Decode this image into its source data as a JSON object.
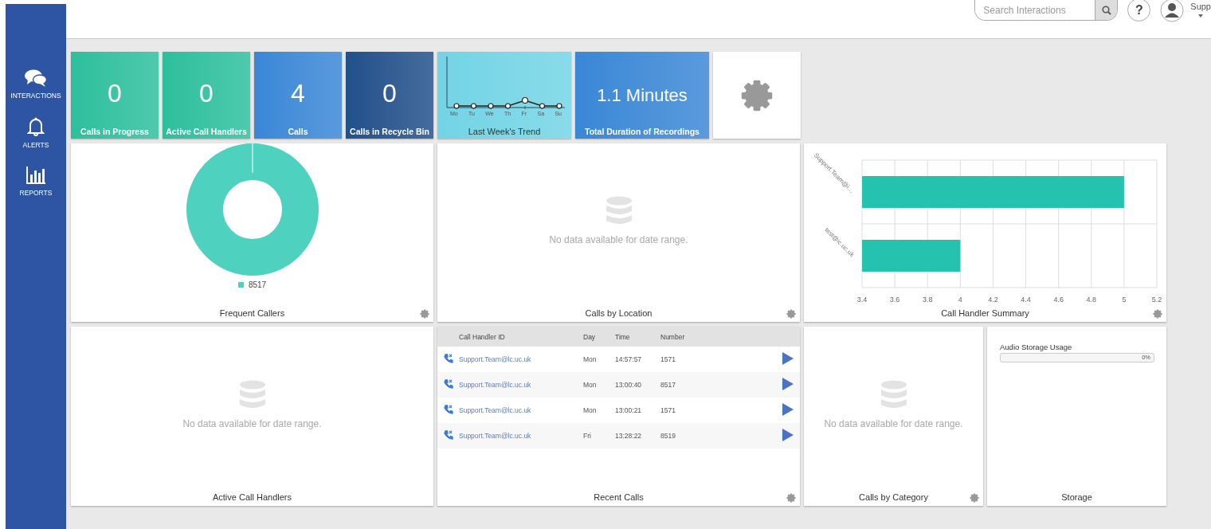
{
  "sidebar": {
    "items": [
      {
        "label": "INTERACTIONS",
        "kind": "chat"
      },
      {
        "label": "ALERTS",
        "kind": "bell"
      },
      {
        "label": "REPORTS",
        "kind": "chart"
      }
    ]
  },
  "header": {
    "search": {
      "placeholder": "Search Interactions"
    },
    "help": "?",
    "user": "Supp"
  },
  "tiles": [
    {
      "kind": "metric",
      "value": "0",
      "label": "Calls in Progress",
      "color": "#2dbf9d"
    },
    {
      "kind": "metric",
      "value": "0",
      "label": "Active Call Handlers",
      "color": "#2dbf9d"
    },
    {
      "kind": "metric",
      "value": "4",
      "label": "Calls",
      "color": "#3a87d6"
    },
    {
      "kind": "metric",
      "value": "0",
      "label": "Calls in Recycle Bin",
      "color": "#22508a"
    },
    {
      "kind": "trend",
      "label": "Last Week's Trend",
      "days": [
        "Mo",
        "Tu",
        "We",
        "Th",
        "Fr",
        "Sa",
        "Su"
      ],
      "color": "#72d4e5"
    },
    {
      "kind": "metric",
      "value": "1.1 Minutes",
      "label": "Total Duration of Recordings",
      "color": "#3a87d6"
    },
    {
      "kind": "settings"
    }
  ],
  "panels": [
    {
      "kind": "donut",
      "title": "Frequent Callers",
      "settings_icon": true,
      "legend": [
        {
          "label": "8517",
          "color": "#4fd1c0"
        }
      ]
    },
    {
      "kind": "empty",
      "title": "Calls by Location",
      "settings_icon": true,
      "message": "No data available for date range."
    },
    {
      "kind": "bar_chart",
      "title": "Call Handler Summary",
      "settings_icon": true,
      "chart_data": {
        "type": "bar",
        "orientation": "horizontal",
        "categories": [
          "Support.Team@i…",
          "test@ic.uc.uk"
        ],
        "values": [
          5,
          4
        ],
        "xlim": [
          3.4,
          5.2
        ],
        "xticks": [
          3.4,
          3.6,
          3.8,
          4,
          4.2,
          4.4,
          4.6,
          4.8,
          5,
          5.2
        ],
        "grid": true
      }
    },
    {
      "kind": "empty",
      "title": "Active Call Handlers",
      "settings_icon": false,
      "message": "No data available for date range."
    },
    {
      "kind": "table",
      "title": "Recent Calls",
      "settings_icon": true,
      "columns": [
        "Call Handler ID",
        "Day",
        "Time",
        "Number"
      ],
      "rows": [
        {
          "id": "Support.Team@lc.uc.uk",
          "day": "Mon",
          "time": "14:57:57",
          "number": "1571"
        },
        {
          "id": "Support.Team@lc.uc.uk",
          "day": "Mon",
          "time": "13:00:40",
          "number": "8517"
        },
        {
          "id": "Support.Team@lc.uc.uk",
          "day": "Mon",
          "time": "13:00:21",
          "number": "1571"
        },
        {
          "id": "Support.Team@lc.uc.uk",
          "day": "Fri",
          "time": "13:28:22",
          "number": "8519"
        }
      ]
    },
    {
      "kind": "empty",
      "title": "Calls by Category",
      "settings_icon": true,
      "message": "No data available for date range."
    },
    {
      "kind": "storage",
      "title": "Storage",
      "settings_icon": false,
      "label": "Audio Storage Usage",
      "level": 0,
      "reading": "0%"
    }
  ]
}
